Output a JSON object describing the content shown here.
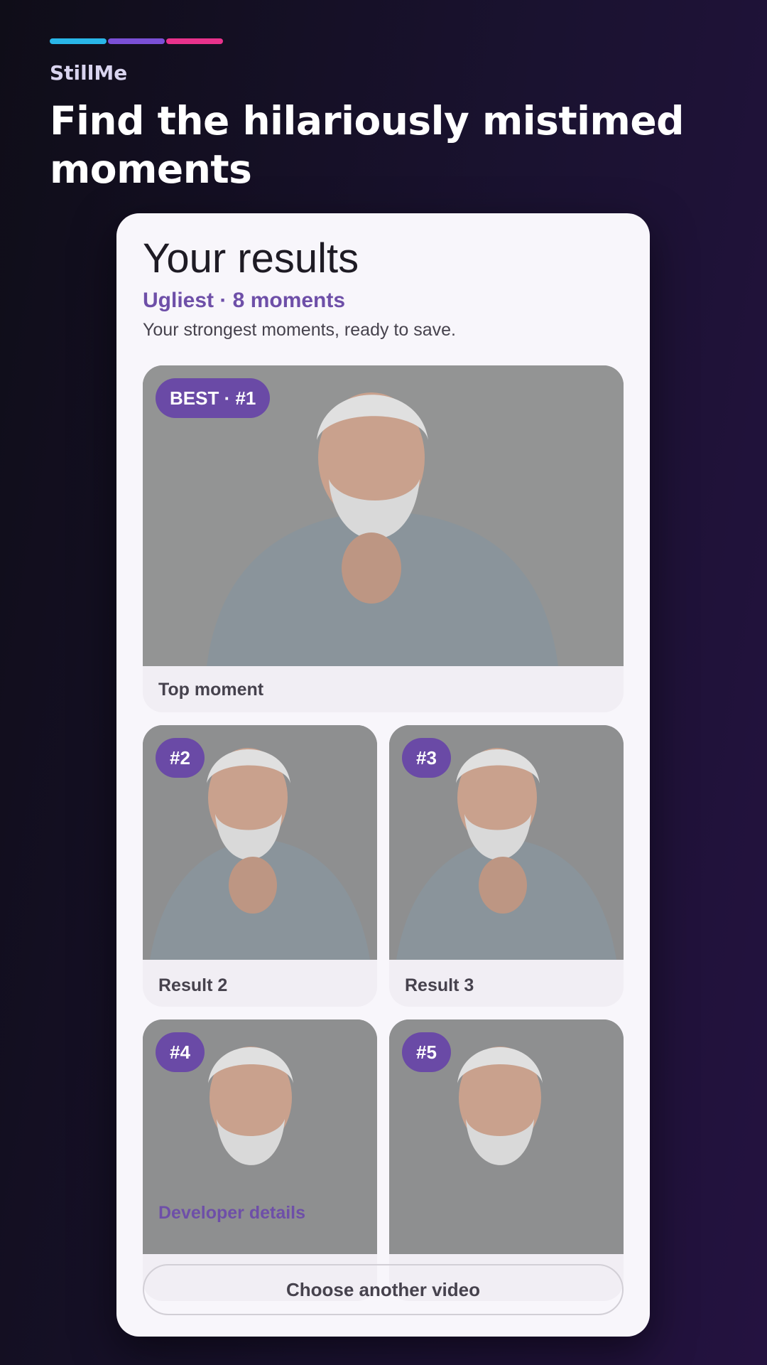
{
  "app": {
    "brand": "StillMe",
    "headline": "Find the hilariously mistimed moments"
  },
  "progress": {
    "segments": [
      "#29b6e8",
      "#7a4fd6",
      "#e8328c"
    ]
  },
  "results": {
    "title": "Your results",
    "subtitle": "Ugliest · 8 moments",
    "description": "Your strongest moments, ready to save.",
    "top": {
      "badge": "BEST · #1",
      "caption": "Top moment"
    },
    "items": [
      {
        "badge": "#2",
        "caption": "Result 2"
      },
      {
        "badge": "#3",
        "caption": "Result 3"
      },
      {
        "badge": "#4",
        "caption": ""
      },
      {
        "badge": "#5",
        "caption": ""
      }
    ]
  },
  "actions": {
    "developer_details": "Developer details",
    "choose_another": "Choose another video"
  },
  "colors": {
    "accent": "#6a4aa6",
    "card_bg": "#f8f6fb"
  }
}
